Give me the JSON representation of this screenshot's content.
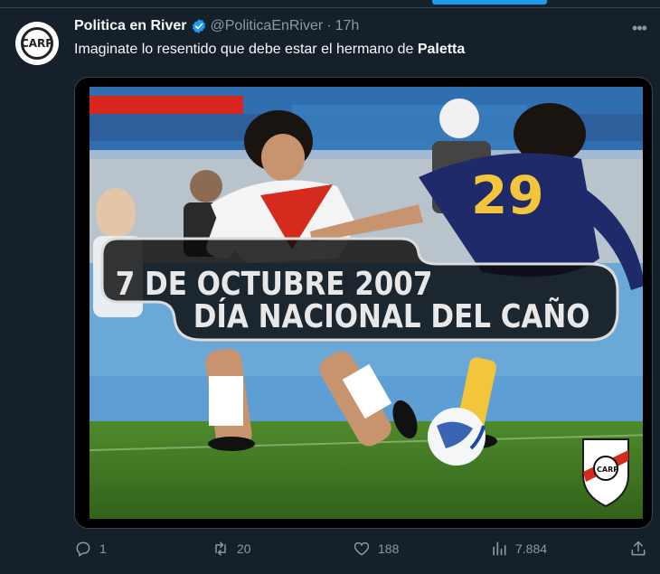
{
  "tweet": {
    "author": {
      "display_name": "Politica en River",
      "handle": "@PoliticaEnRiver",
      "time_separator": "·",
      "time": "17h",
      "avatar_text": "CARP"
    },
    "text_prefix": "Imaginate lo resentido que debe estar el hermano de ",
    "text_bold": "Paletta",
    "media": {
      "line1": "7 DE OCTUBRE 2007",
      "line2": "DÍA NACIONAL DEL CAÑO",
      "jersey_number": "29",
      "shield_text": "CARP"
    },
    "actions": {
      "replies": "1",
      "retweets": "20",
      "likes": "188",
      "views": "7.884"
    }
  },
  "colors": {
    "background": "#15202b",
    "accent": "#1d9bf0",
    "secondary_text": "#8b98a5"
  }
}
